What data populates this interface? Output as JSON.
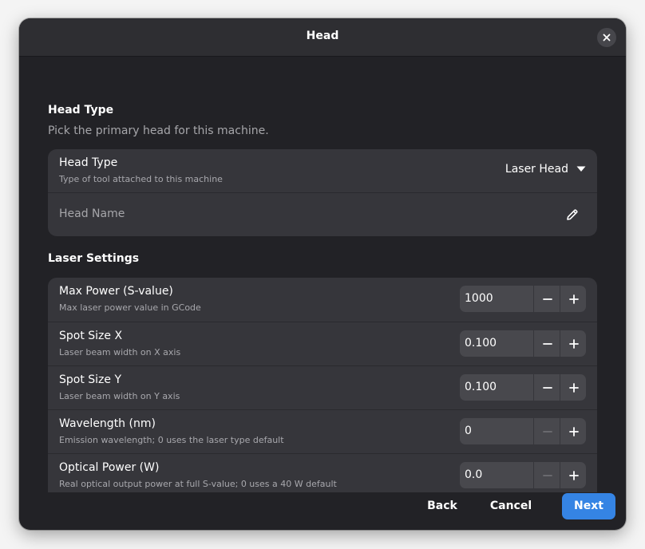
{
  "dialog": {
    "title": "Head"
  },
  "head_type_section": {
    "title": "Head Type",
    "description": "Pick the primary head for this machine.",
    "head_type_row": {
      "title": "Head Type",
      "subtitle": "Type of tool attached to this machine",
      "value": "Laser Head"
    },
    "head_name_row": {
      "placeholder": "Head Name"
    }
  },
  "laser_section": {
    "title": "Laser Settings",
    "rows": [
      {
        "title": "Max Power (S-value)",
        "subtitle": "Max laser power value in GCode",
        "value": "1000",
        "minus_enabled": true
      },
      {
        "title": "Spot Size X",
        "subtitle": "Laser beam width on X axis",
        "value": "0.100",
        "minus_enabled": true
      },
      {
        "title": "Spot Size Y",
        "subtitle": "Laser beam width on Y axis",
        "value": "0.100",
        "minus_enabled": true
      },
      {
        "title": "Wavelength (nm)",
        "subtitle": "Emission wavelength; 0 uses the laser type default",
        "value": "0",
        "minus_enabled": false
      },
      {
        "title": "Optical Power (W)",
        "subtitle": "Real optical output power at full S-value; 0 uses a 40 W default",
        "value": "0.0",
        "minus_enabled": false
      }
    ]
  },
  "footer": {
    "back": "Back",
    "cancel": "Cancel",
    "next": "Next"
  },
  "colors": {
    "accent": "#3584e4",
    "dialog_bg": "#222226",
    "card_bg": "#36363b",
    "spin_bg": "#48484d"
  },
  "icons": {
    "close": "close-icon",
    "dropdown": "chevron-down-icon",
    "edit": "pencil-icon",
    "minus": "minus-icon",
    "plus": "plus-icon"
  }
}
